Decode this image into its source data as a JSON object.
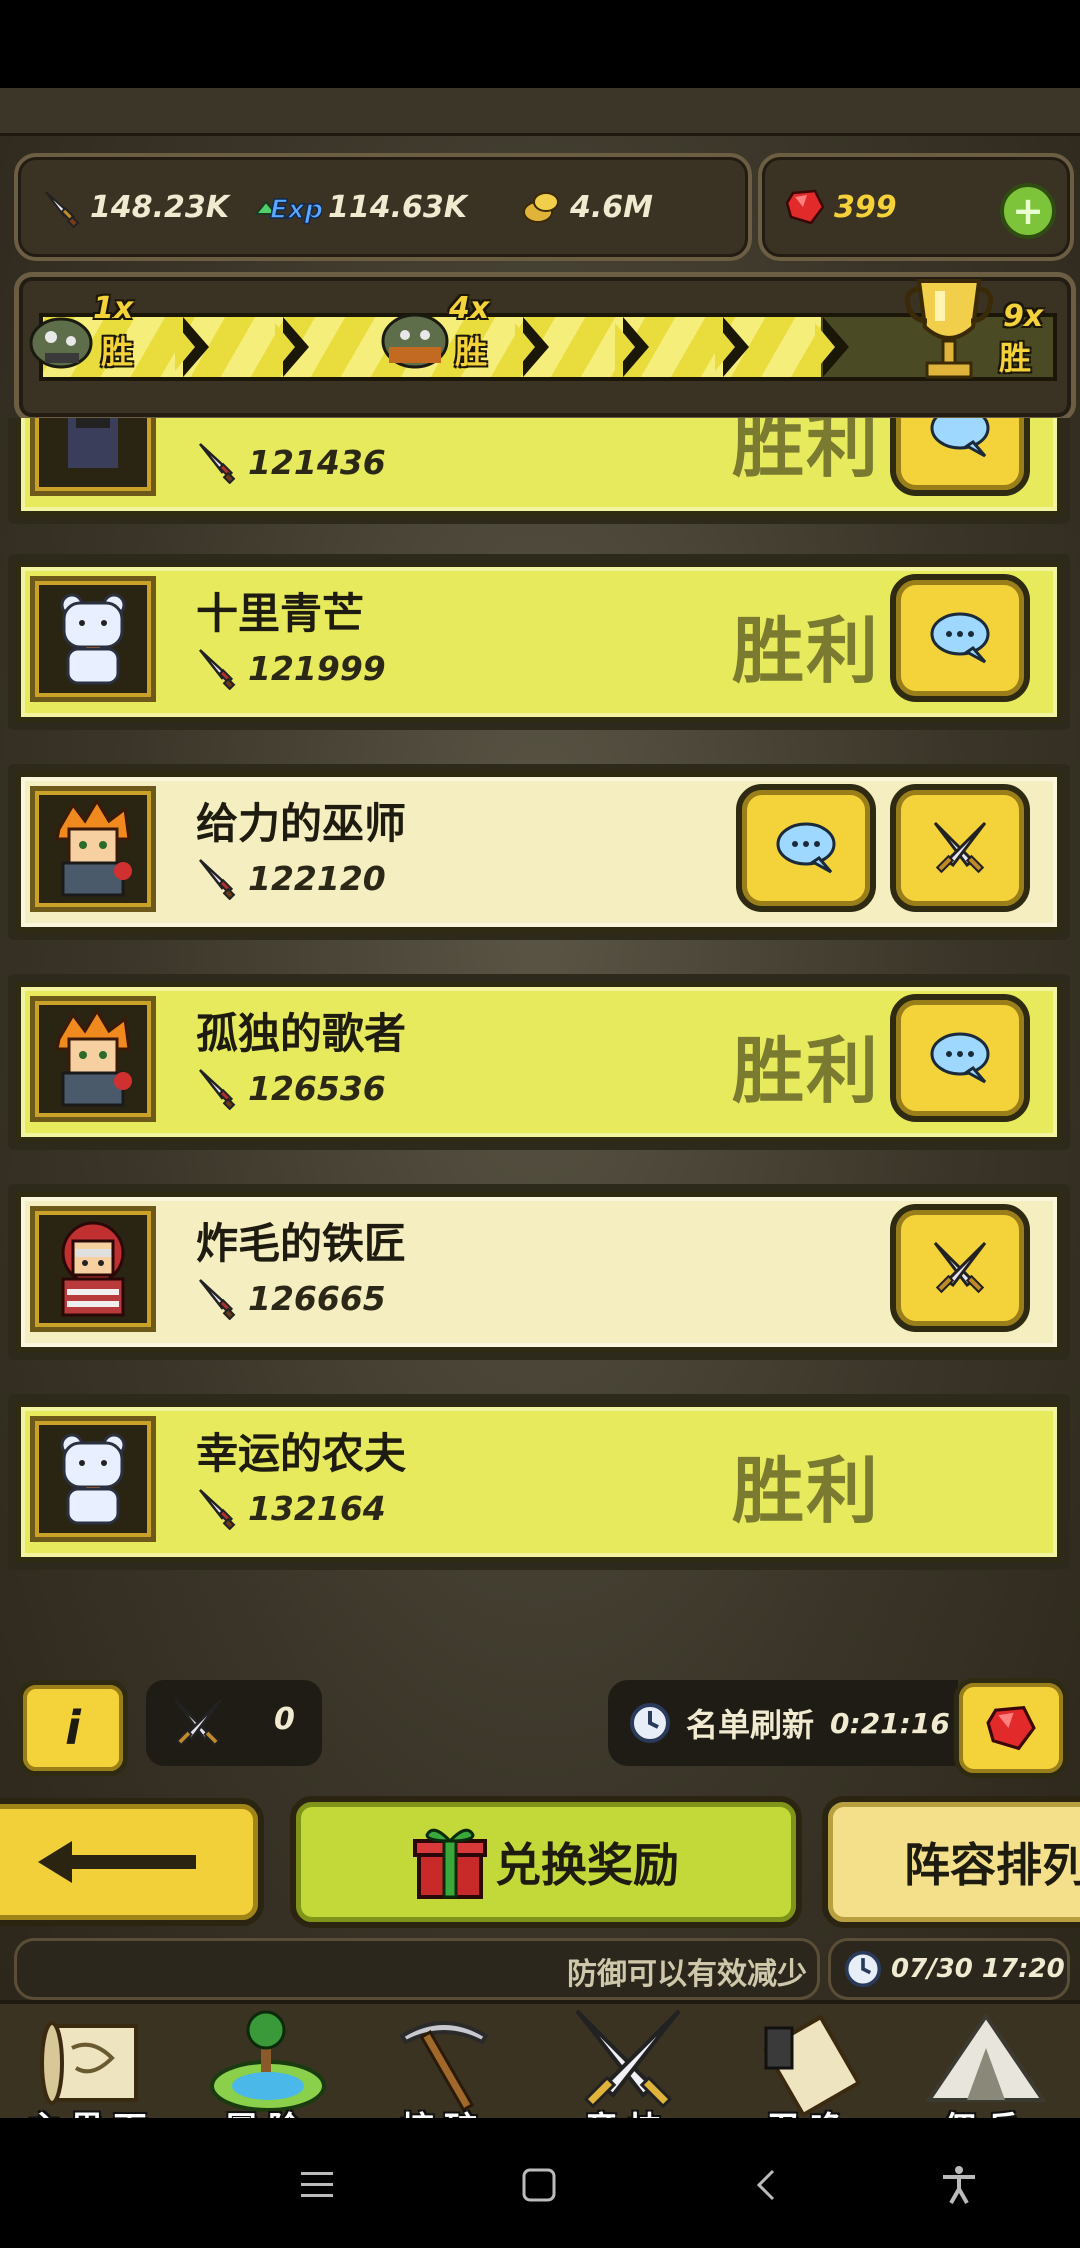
{
  "resources": {
    "attack": "148.23K",
    "exp": "114.63K",
    "exp_icon_text": "Exp",
    "gold": "4.6M",
    "gems": "399",
    "plus": "+"
  },
  "progress": {
    "milestones": [
      {
        "mult": "1x",
        "win": "胜"
      },
      {
        "mult": "4x",
        "win": "胜"
      },
      {
        "mult": "9x",
        "win": "胜"
      }
    ],
    "fill_fraction": 0.77
  },
  "opponents": [
    {
      "name": "",
      "power": "121436",
      "status": "胜利",
      "has_chat": true,
      "has_attack": false
    },
    {
      "name": "十里青芒",
      "power": "121999",
      "status": "胜利",
      "has_chat": true,
      "has_attack": false
    },
    {
      "name": "给力的巫师",
      "power": "122120",
      "status": "",
      "has_chat": true,
      "has_attack": true
    },
    {
      "name": "孤独的歌者",
      "power": "126536",
      "status": "胜利",
      "has_chat": true,
      "has_attack": false
    },
    {
      "name": "炸毛的铁匠",
      "power": "126665",
      "status": "",
      "has_chat": false,
      "has_attack": true
    },
    {
      "name": "幸运的农夫",
      "power": "132164",
      "status": "胜利",
      "has_chat": false,
      "has_attack": false
    }
  ],
  "controls": {
    "info": "i",
    "attack_count": "0",
    "refresh_label": "名单刷新",
    "refresh_time": "0:21:16"
  },
  "actions": {
    "exchange": "兑换奖励",
    "lineup": "阵容排列"
  },
  "ticker": {
    "text": "防御可以有效减少",
    "datetime": "07/30 17:20"
  },
  "nav": {
    "items": [
      {
        "label": "主界面"
      },
      {
        "label": "冒险"
      },
      {
        "label": "挖矿"
      },
      {
        "label": "竞技"
      },
      {
        "label": "召唤"
      },
      {
        "label": "佣兵"
      }
    ]
  },
  "colors": {
    "row_green": "#e7ea5c",
    "row_cream": "#f4eec0",
    "button_gold": "#f4d23a",
    "win_text": "#7a7a30"
  }
}
